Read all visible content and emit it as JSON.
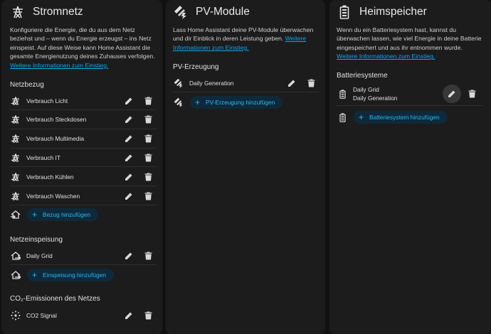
{
  "grid": {
    "title": "Stromnetz",
    "desc": "Konfiguriere die Energie, die du aus dem Netz beziehst und – wenn du Energie erzeugst – ins Netz einspeist. Auf diese Weise kann Home Assistant die gesamte Energienutzung deines Zuhauses verfolgen.",
    "link": "Weitere Informationen zum Einstieg.",
    "consumption_title": "Netzbezug",
    "consumption": [
      "Verbrauch Licht",
      "Verbrauch Steckdosen",
      "Verbrauch Multimedia",
      "Verbrauch IT",
      "Verbrauch Kühlen",
      "Verbrauch Waschen"
    ],
    "add_consumption": "Bezug hinzufügen",
    "return_title": "Netzeinspeisung",
    "returns": [
      "Daily Grid"
    ],
    "add_return": "Einspeisung hinzufügen",
    "co2_title": "CO₂-Emissionen des Netzes",
    "co2": [
      "CO2 Signal"
    ]
  },
  "solar": {
    "title": "PV-Module",
    "desc": "Lass Home Assistant deine PV-Module überwachen und dir Einblick in deren Leistung geben.",
    "link": "Weitere Informationen zum Einstieg.",
    "section_title": "PV-Erzeugung",
    "items": [
      "Daily Generation"
    ],
    "add": "PV-Erzeugung hinzufügen"
  },
  "battery": {
    "title": "Heimspeicher",
    "desc": "Wenn du ein Batteriesystem hast, kannst du überwachen lassen, wie viel Energie in deine Batterie eingespeichert und aus ihr entnommen wurde.",
    "link": "Weitere Informationen zum Einstieg.",
    "section_title": "Batteriesysteme",
    "item_line1": "Daily Grid",
    "item_line2": "Daily Generation",
    "add": "Batteriesystem hinzufügen"
  },
  "colors": {
    "accent": "#03a9f4",
    "card": "#1c1c1c",
    "background": "#111111"
  }
}
